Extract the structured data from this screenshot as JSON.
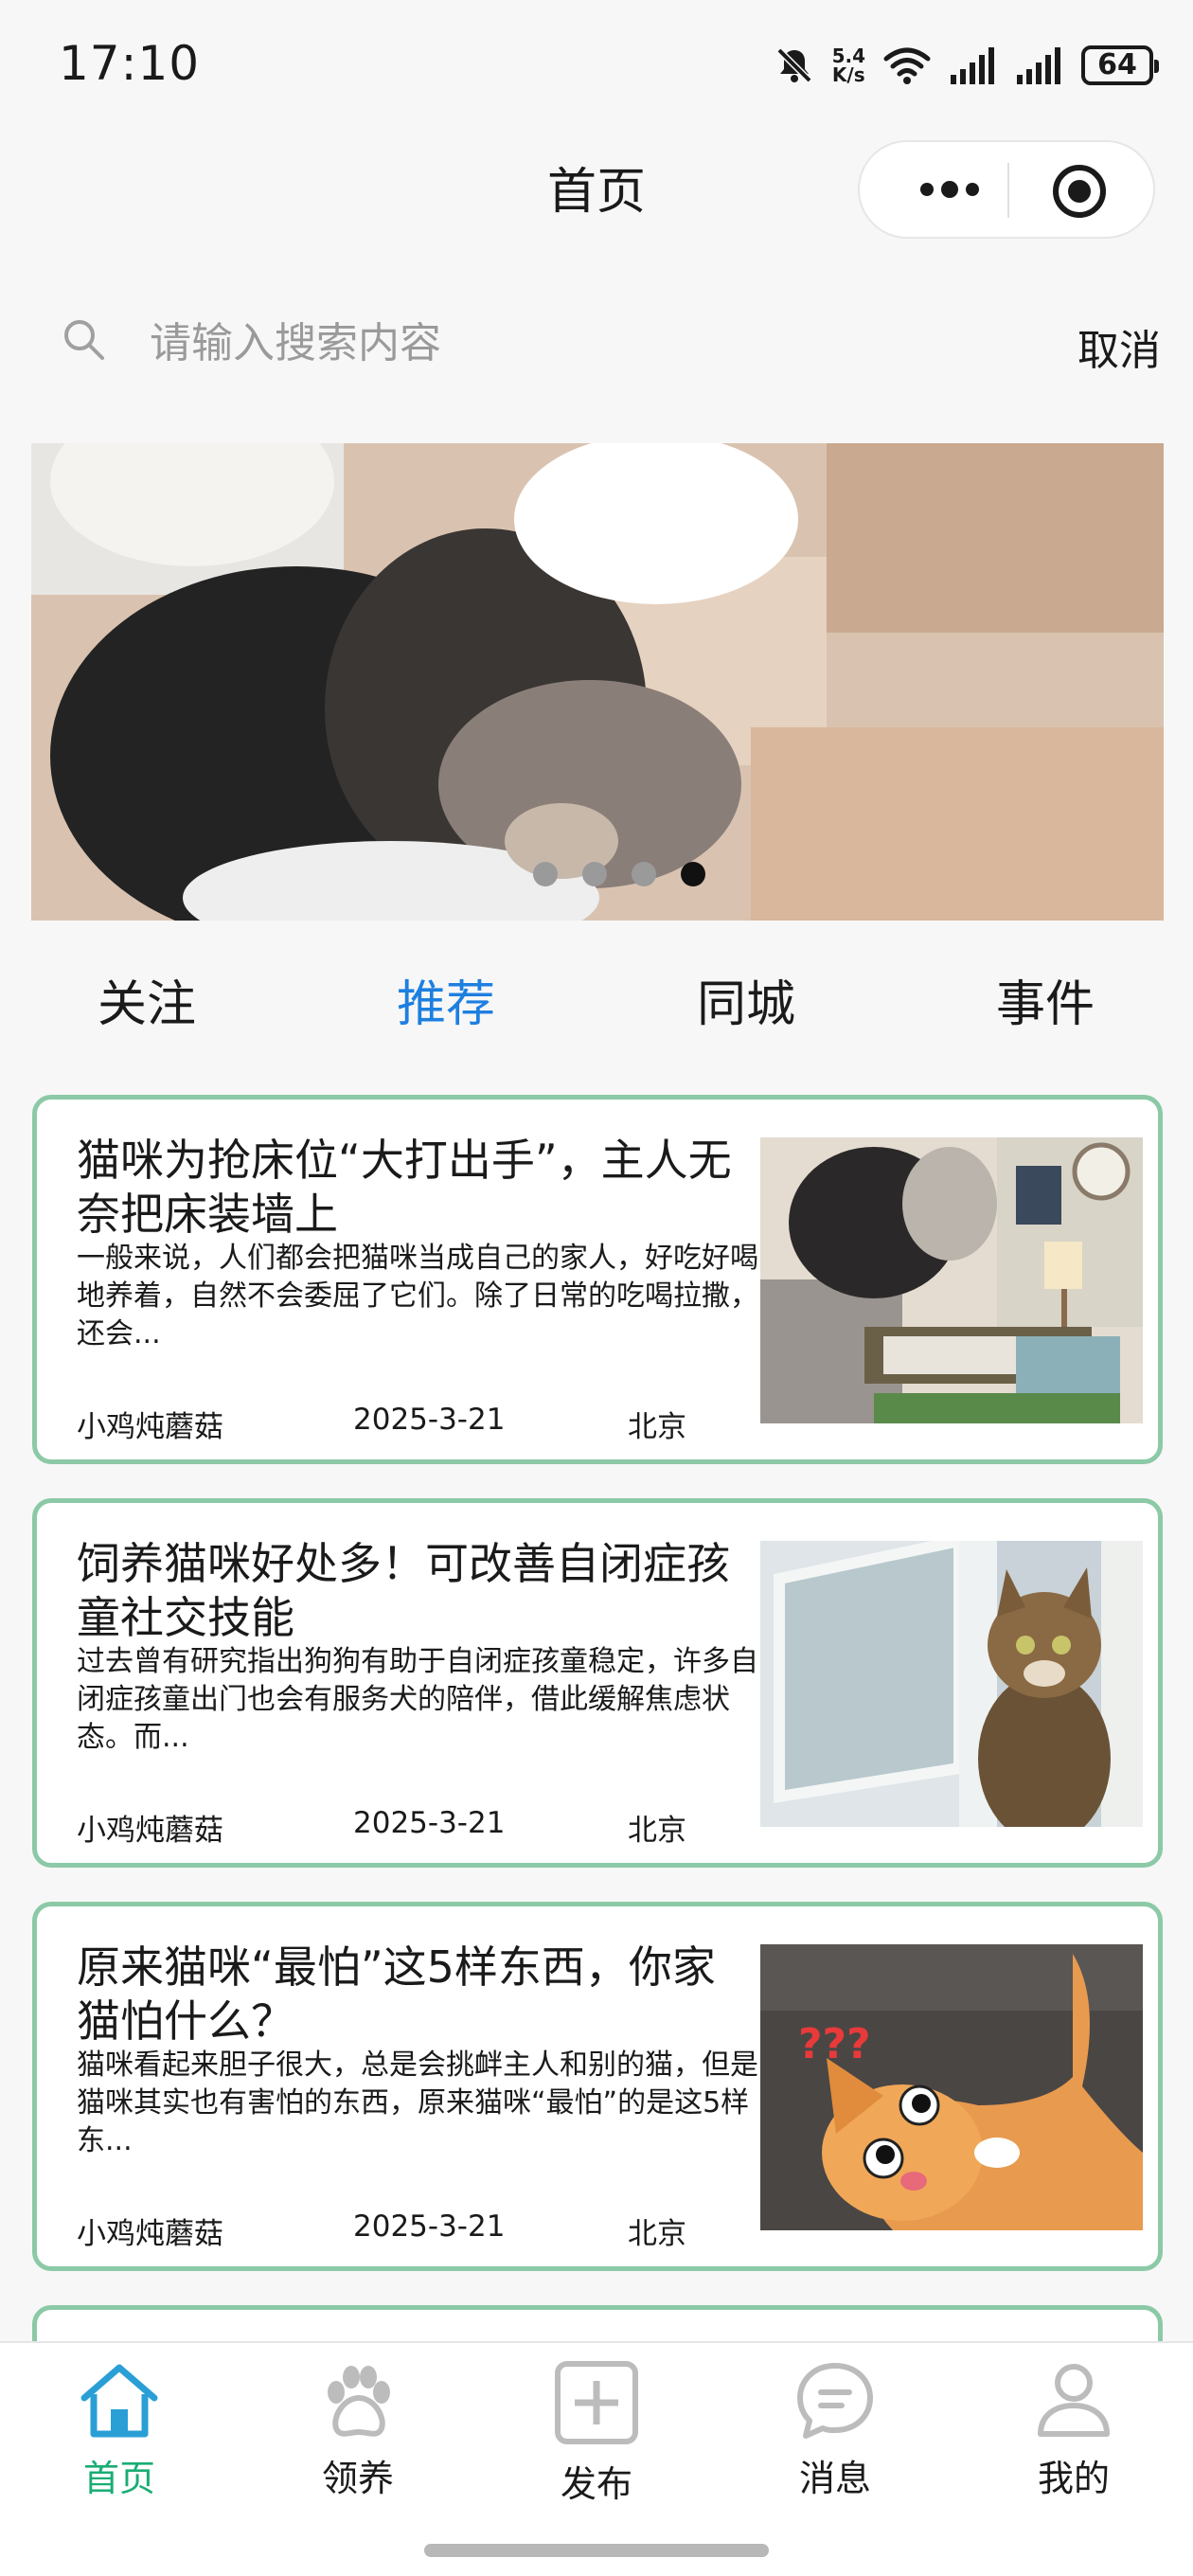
{
  "status_bar": {
    "time": "17:10",
    "network_speed_value": "5.4",
    "network_speed_unit": "K/s",
    "battery": "64",
    "icons": [
      "mute-bell-icon",
      "wifi-icon",
      "signal-icon",
      "signal-icon",
      "battery-icon"
    ]
  },
  "nav": {
    "title": "首页",
    "capsule_icons": [
      "more-dots-icon",
      "target-icon"
    ]
  },
  "search": {
    "placeholder": "请输入搜索内容",
    "value": "",
    "cancel_label": "取消"
  },
  "banner": {
    "slide_count": 4,
    "active_slide": 4
  },
  "tabs": [
    {
      "label": "关注",
      "active": false
    },
    {
      "label": "推荐",
      "active": true
    },
    {
      "label": "同城",
      "active": false
    },
    {
      "label": "事件",
      "active": false
    }
  ],
  "articles": [
    {
      "title": "猫咪为抢床位“大打出手”，主人无奈把床装墙上",
      "summary": "一般来说，人们都会把猫咪当成自己的家人，好吃好喝地养着，自然不会委屈了它们。除了日常的吃喝拉撒，还会...",
      "author": "小鸡炖蘑菇",
      "date": "2025-3-21",
      "city": "北京"
    },
    {
      "title": "饲养猫咪好处多！可改善自闭症孩童社交技能",
      "summary": "过去曾有研究指出狗狗有助于自闭症孩童稳定，许多自闭症孩童出门也会有服务犬的陪伴，借此缓解焦虑状态。而...",
      "author": "小鸡炖蘑菇",
      "date": "2025-3-21",
      "city": "北京"
    },
    {
      "title": "原来猫咪“最怕”这5样东西，你家猫怕什么？",
      "summary": "猫咪看起来胆子很大，总是会挑衅主人和别的猫，但是猫咪其实也有害怕的东西，原来猫咪“最怕”的是这5样东...",
      "author": "小鸡炖蘑菇",
      "date": "2025-3-21",
      "city": "北京"
    }
  ],
  "tabbar": [
    {
      "label": "首页",
      "icon": "home-icon",
      "active": true
    },
    {
      "label": "领养",
      "icon": "paw-icon",
      "active": false
    },
    {
      "label": "发布",
      "icon": "plus-square-icon",
      "active": false
    },
    {
      "label": "消息",
      "icon": "chat-bubble-icon",
      "active": false
    },
    {
      "label": "我的",
      "icon": "person-icon",
      "active": false
    }
  ],
  "colors": {
    "accent_tab": "#1d7fe0",
    "tabbar_active": "#1aad74",
    "card_border": "#8cc9a6",
    "background": "#f7f7f7"
  }
}
